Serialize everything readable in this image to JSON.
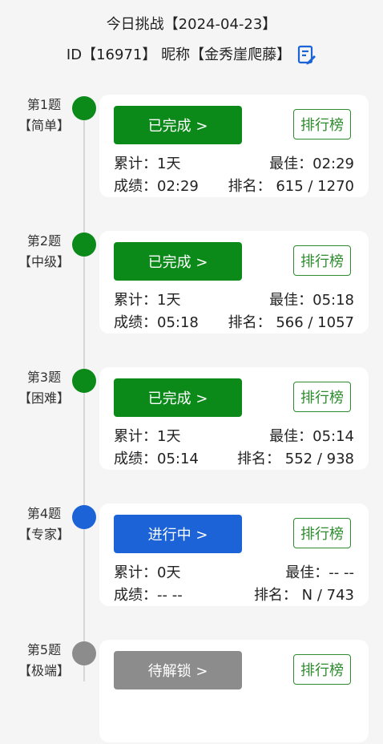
{
  "header": {
    "line1": "今日挑战【2024-04-23】",
    "line2": "ID【16971】 昵称【金秀崖爬藤】"
  },
  "colors": {
    "done": "#0b8a1a",
    "in_progress": "#1b63d6",
    "locked": "#8c8c8c",
    "rank_border": "#2e8b2e"
  },
  "items": [
    {
      "q_label": "第1题",
      "difficulty": "【简单】",
      "status": "已完成 >",
      "rank_btn": "排行榜",
      "cumulative": "累计：1天",
      "best": "最佳：02:29",
      "score": "成绩：02:29",
      "rank": "排名： 615 / 1270"
    },
    {
      "q_label": "第2题",
      "difficulty": "【中级】",
      "status": "已完成 >",
      "rank_btn": "排行榜",
      "cumulative": "累计：1天",
      "best": "最佳：05:18",
      "score": "成绩：05:18",
      "rank": "排名： 566 / 1057"
    },
    {
      "q_label": "第3题",
      "difficulty": "【困难】",
      "status": "已完成 >",
      "rank_btn": "排行榜",
      "cumulative": "累计：1天",
      "best": "最佳：05:14",
      "score": "成绩：05:14",
      "rank": "排名： 552 / 938"
    },
    {
      "q_label": "第4题",
      "difficulty": "【专家】",
      "status": "进行中 >",
      "rank_btn": "排行榜",
      "cumulative": "累计：0天",
      "best": "最佳：-- --",
      "score": "成绩：-- --",
      "rank": "排名： N / 743"
    },
    {
      "q_label": "第5题",
      "difficulty": "【极端】",
      "status": "待解锁 >",
      "rank_btn": "排行榜"
    }
  ]
}
